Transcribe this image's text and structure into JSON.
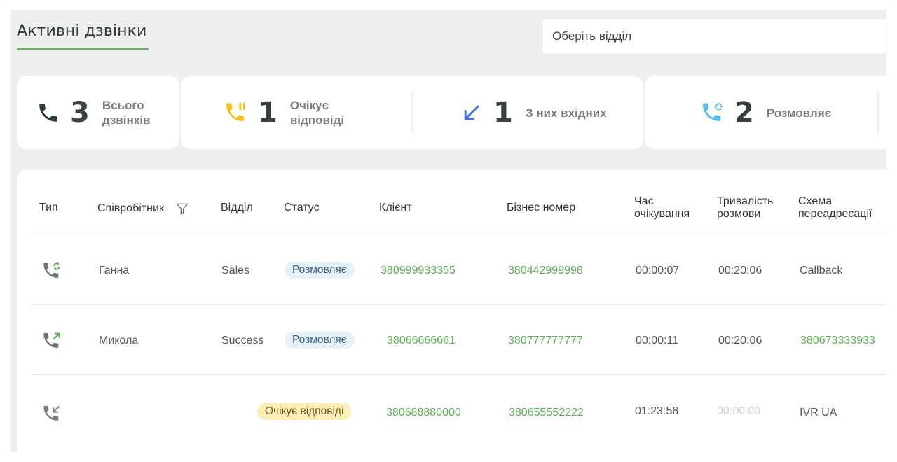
{
  "header": {
    "title": "Активні дзвінки"
  },
  "department_select": {
    "placeholder": "Оберіть відділ"
  },
  "stats": [
    {
      "icon": "phone-icon",
      "value": "3",
      "label_line1": "Всього",
      "label_line2": "дзвінків",
      "color": "#2f3a3c"
    },
    {
      "icon": "phone-waiting-icon",
      "value": "1",
      "label_line1": "Очікує",
      "label_line2": "відповіді",
      "color": "#f2c31b"
    },
    {
      "icon": "incoming-arrow-icon",
      "value": "1",
      "label_line1": "З них вхідних",
      "label_line2": "",
      "color": "#3f6ff0"
    },
    {
      "icon": "phone-talking-icon",
      "value": "2",
      "label_line1": "Розмовляє",
      "label_line2": "",
      "color": "#5bbde8"
    }
  ],
  "table": {
    "columns": {
      "type": "Тип",
      "employee": "Співробітник",
      "department": "Відділ",
      "status": "Статус",
      "client": "Клієнт",
      "business": "Бізнес номер",
      "wait_line1": "Час",
      "wait_line2": "очікування",
      "duration_line1": "Тривалість",
      "duration_line2": "розмови",
      "scheme_line1": "Схема",
      "scheme_line2": "переадресації"
    },
    "rows": [
      {
        "type_icon": "phone-callback-icon",
        "employee": "Ганна",
        "department": "Sales",
        "status": "Розмовляє",
        "client": "380999933355",
        "business": "380442999998",
        "wait": "00:00:07",
        "duration": "00:20:06",
        "scheme": "Callback"
      },
      {
        "type_icon": "phone-outgoing-icon",
        "employee": "Микола",
        "department": "Success",
        "status": "Розмовляє",
        "client": "38066666661",
        "business": "380777777777",
        "wait": "00:00:11",
        "duration": "00:20:06",
        "scheme": "380673333933"
      },
      {
        "type_icon": "phone-incoming-icon",
        "employee": "",
        "department": "",
        "status": "Очікує відповіді",
        "client": "380688880000",
        "business": "380655552222",
        "wait": "01:23:58",
        "duration": "00:00:00",
        "scheme": "IVR UA"
      }
    ]
  }
}
